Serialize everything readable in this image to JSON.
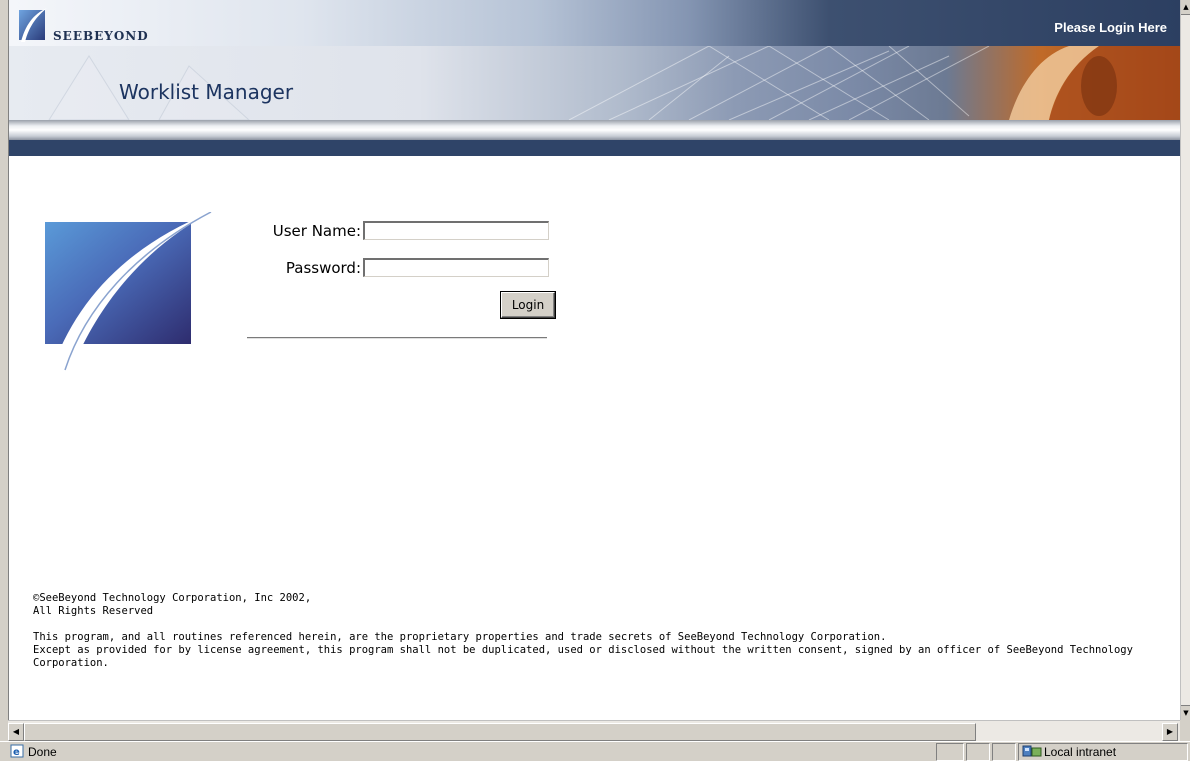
{
  "header": {
    "brand": "SeeBeyond",
    "login_prompt": "Please Login Here",
    "app_title": "Worklist Manager"
  },
  "login": {
    "username_label": "User Name:",
    "username_value": "",
    "password_label": "Password:",
    "password_value": "",
    "login_button": "Login"
  },
  "footer": {
    "copyright_line1": "©SeeBeyond Technology Corporation, Inc 2002,",
    "copyright_line2": "All Rights Reserved",
    "legal_line1": "This program, and all routines referenced herein, are the proprietary properties and trade secrets of SeeBeyond Technology Corporation.",
    "legal_line2": "Except as provided for by license agreement, this program shall not be duplicated, used or disclosed without the written consent, signed by an officer of SeeBeyond Technology",
    "legal_line3": "Corporation."
  },
  "statusbar": {
    "status": "Done",
    "zone": "Local intranet"
  },
  "icons": {
    "logo": "seebeyond-logo-icon",
    "page_status": "ie-page-icon",
    "zone": "intranet-zone-icon"
  },
  "colors": {
    "header_navy": "#2f4468",
    "title_blue": "#1c3460",
    "logo_purple": "#3b3f8a",
    "logo_blue": "#4f8ad0"
  }
}
